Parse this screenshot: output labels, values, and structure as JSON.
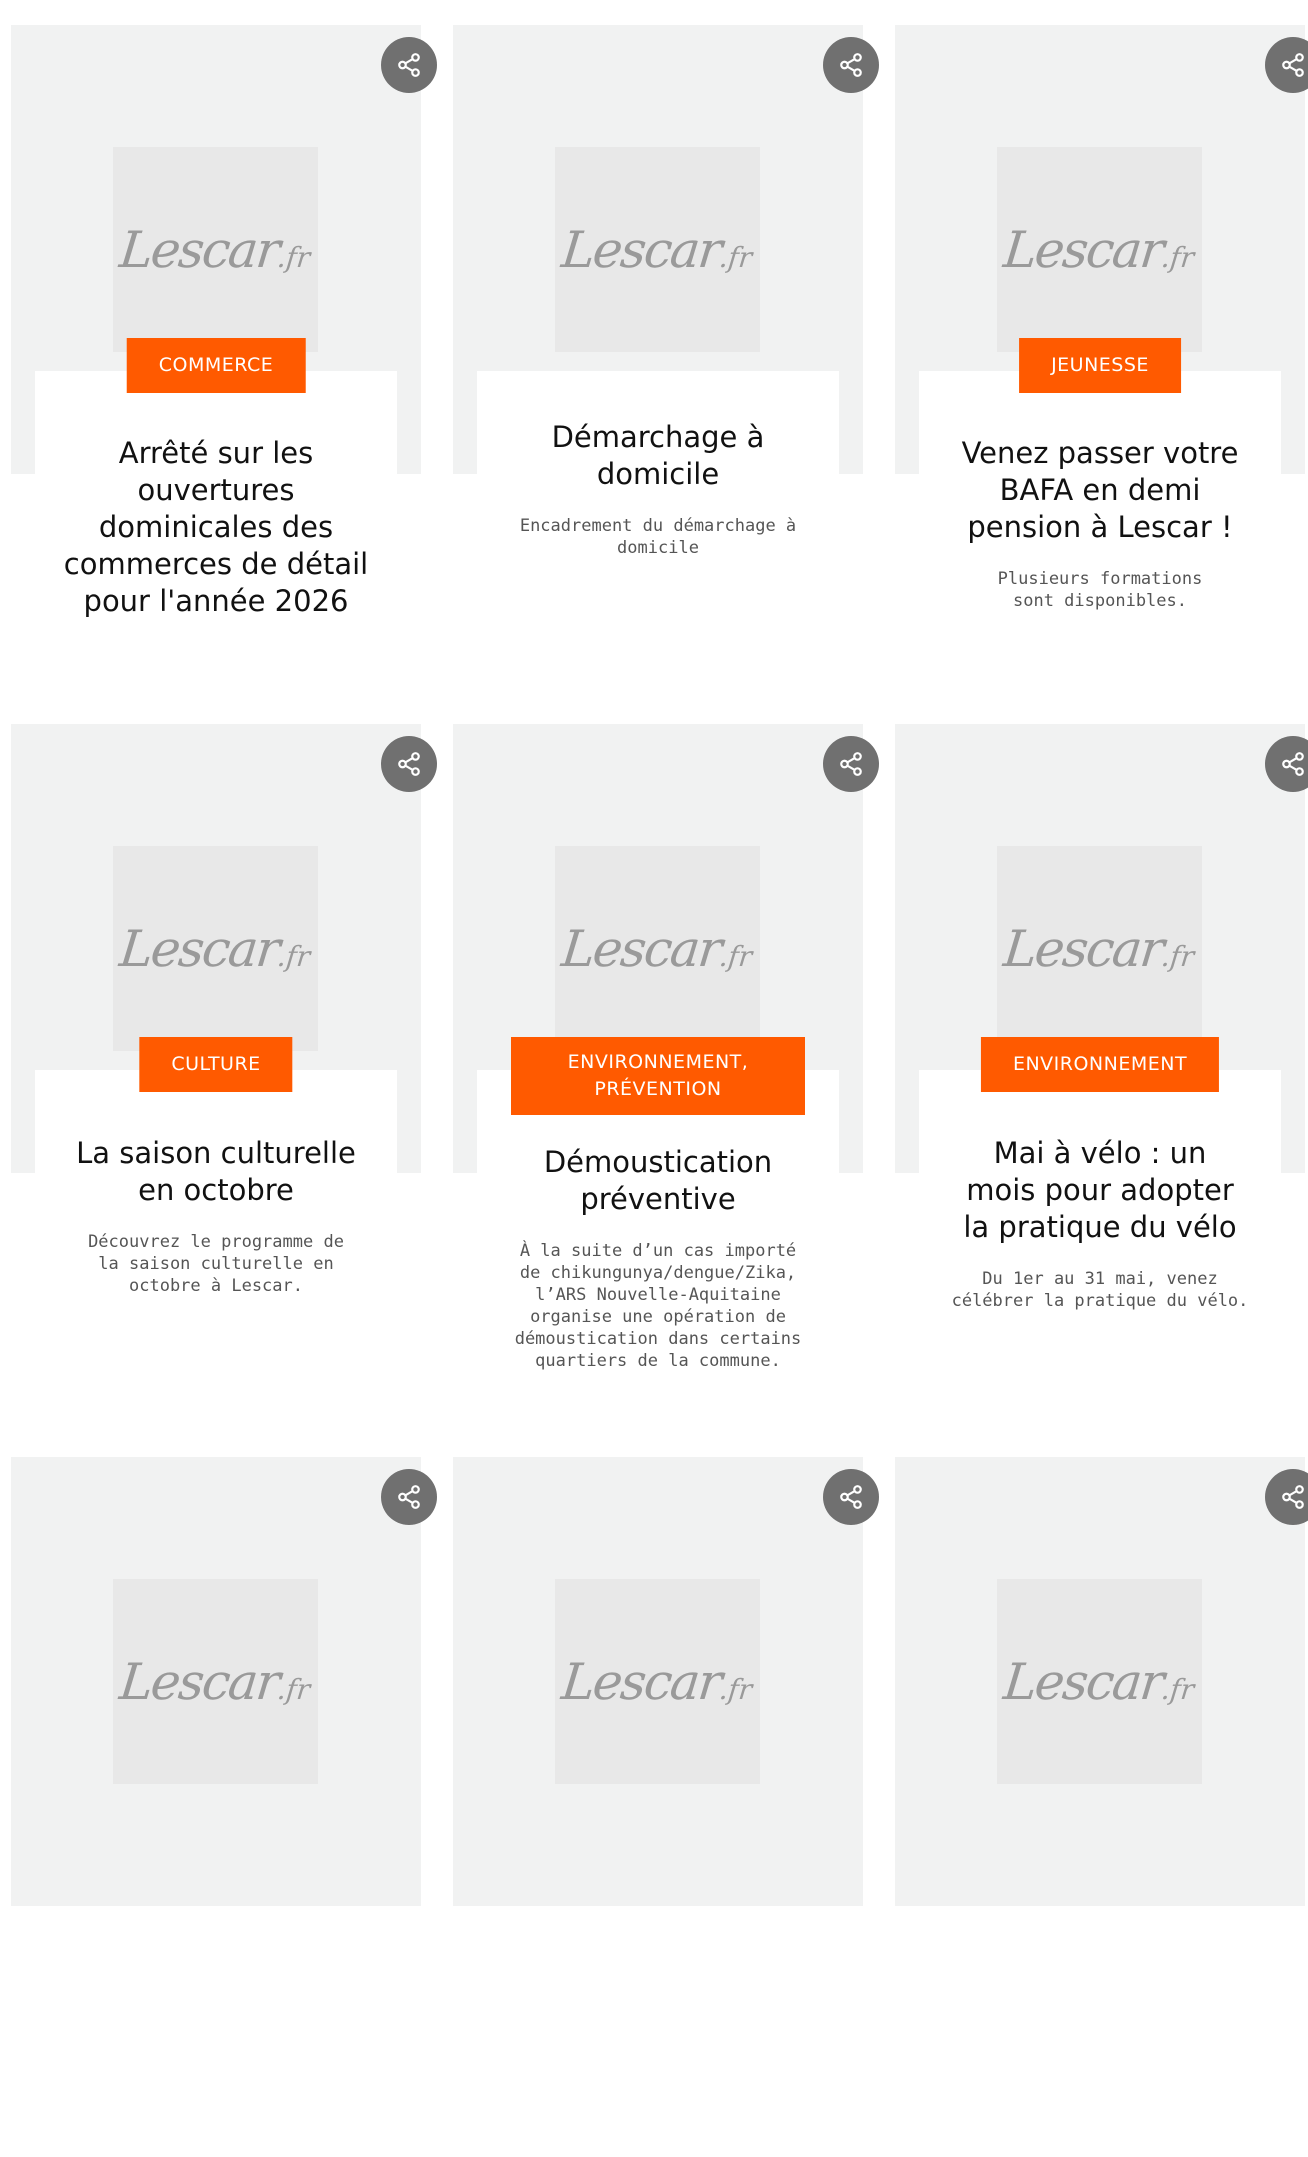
{
  "logo": {
    "text": "Lescar",
    "ext": ".fr"
  },
  "cards": [
    {
      "tag": "COMMERCE",
      "title": "Arrêté sur les ouvertures dominicales des commerces de détail pour l'année 2026",
      "desc": ""
    },
    {
      "tag": "",
      "title": "Démarchage à domicile",
      "desc": "Encadrement du démarchage à domicile"
    },
    {
      "tag": "JEUNESSE",
      "title": "Venez passer votre BAFA en demi pension à Lescar !",
      "desc": "Plusieurs formations sont disponibles."
    },
    {
      "tag": "CULTURE",
      "title": "La saison culturelle en octobre",
      "desc": "Découvrez le programme de la saison culturelle en octobre à Lescar."
    },
    {
      "tag": "ENVIRONNEMENT, PRÉVENTION",
      "title": "Démoustication préventive",
      "desc": "À la suite d’un cas importé de chikungunya/dengue/Zika, l’ARS Nouvelle-Aquitaine organise une opération de démoustication dans certains quartiers de la commune."
    },
    {
      "tag": "ENVIRONNEMENT",
      "title": "Mai à vélo : un mois pour adopter la pratique du vélo",
      "desc": "Du 1er au 31 mai, venez célébrer la pratique du vélo."
    },
    {
      "tag": "",
      "title": "",
      "desc": ""
    },
    {
      "tag": "",
      "title": "",
      "desc": ""
    },
    {
      "tag": "",
      "title": "",
      "desc": ""
    }
  ],
  "icons": {
    "share": "share-icon"
  },
  "colors": {
    "accent": "#ff5a00",
    "share_bg": "#707070"
  }
}
